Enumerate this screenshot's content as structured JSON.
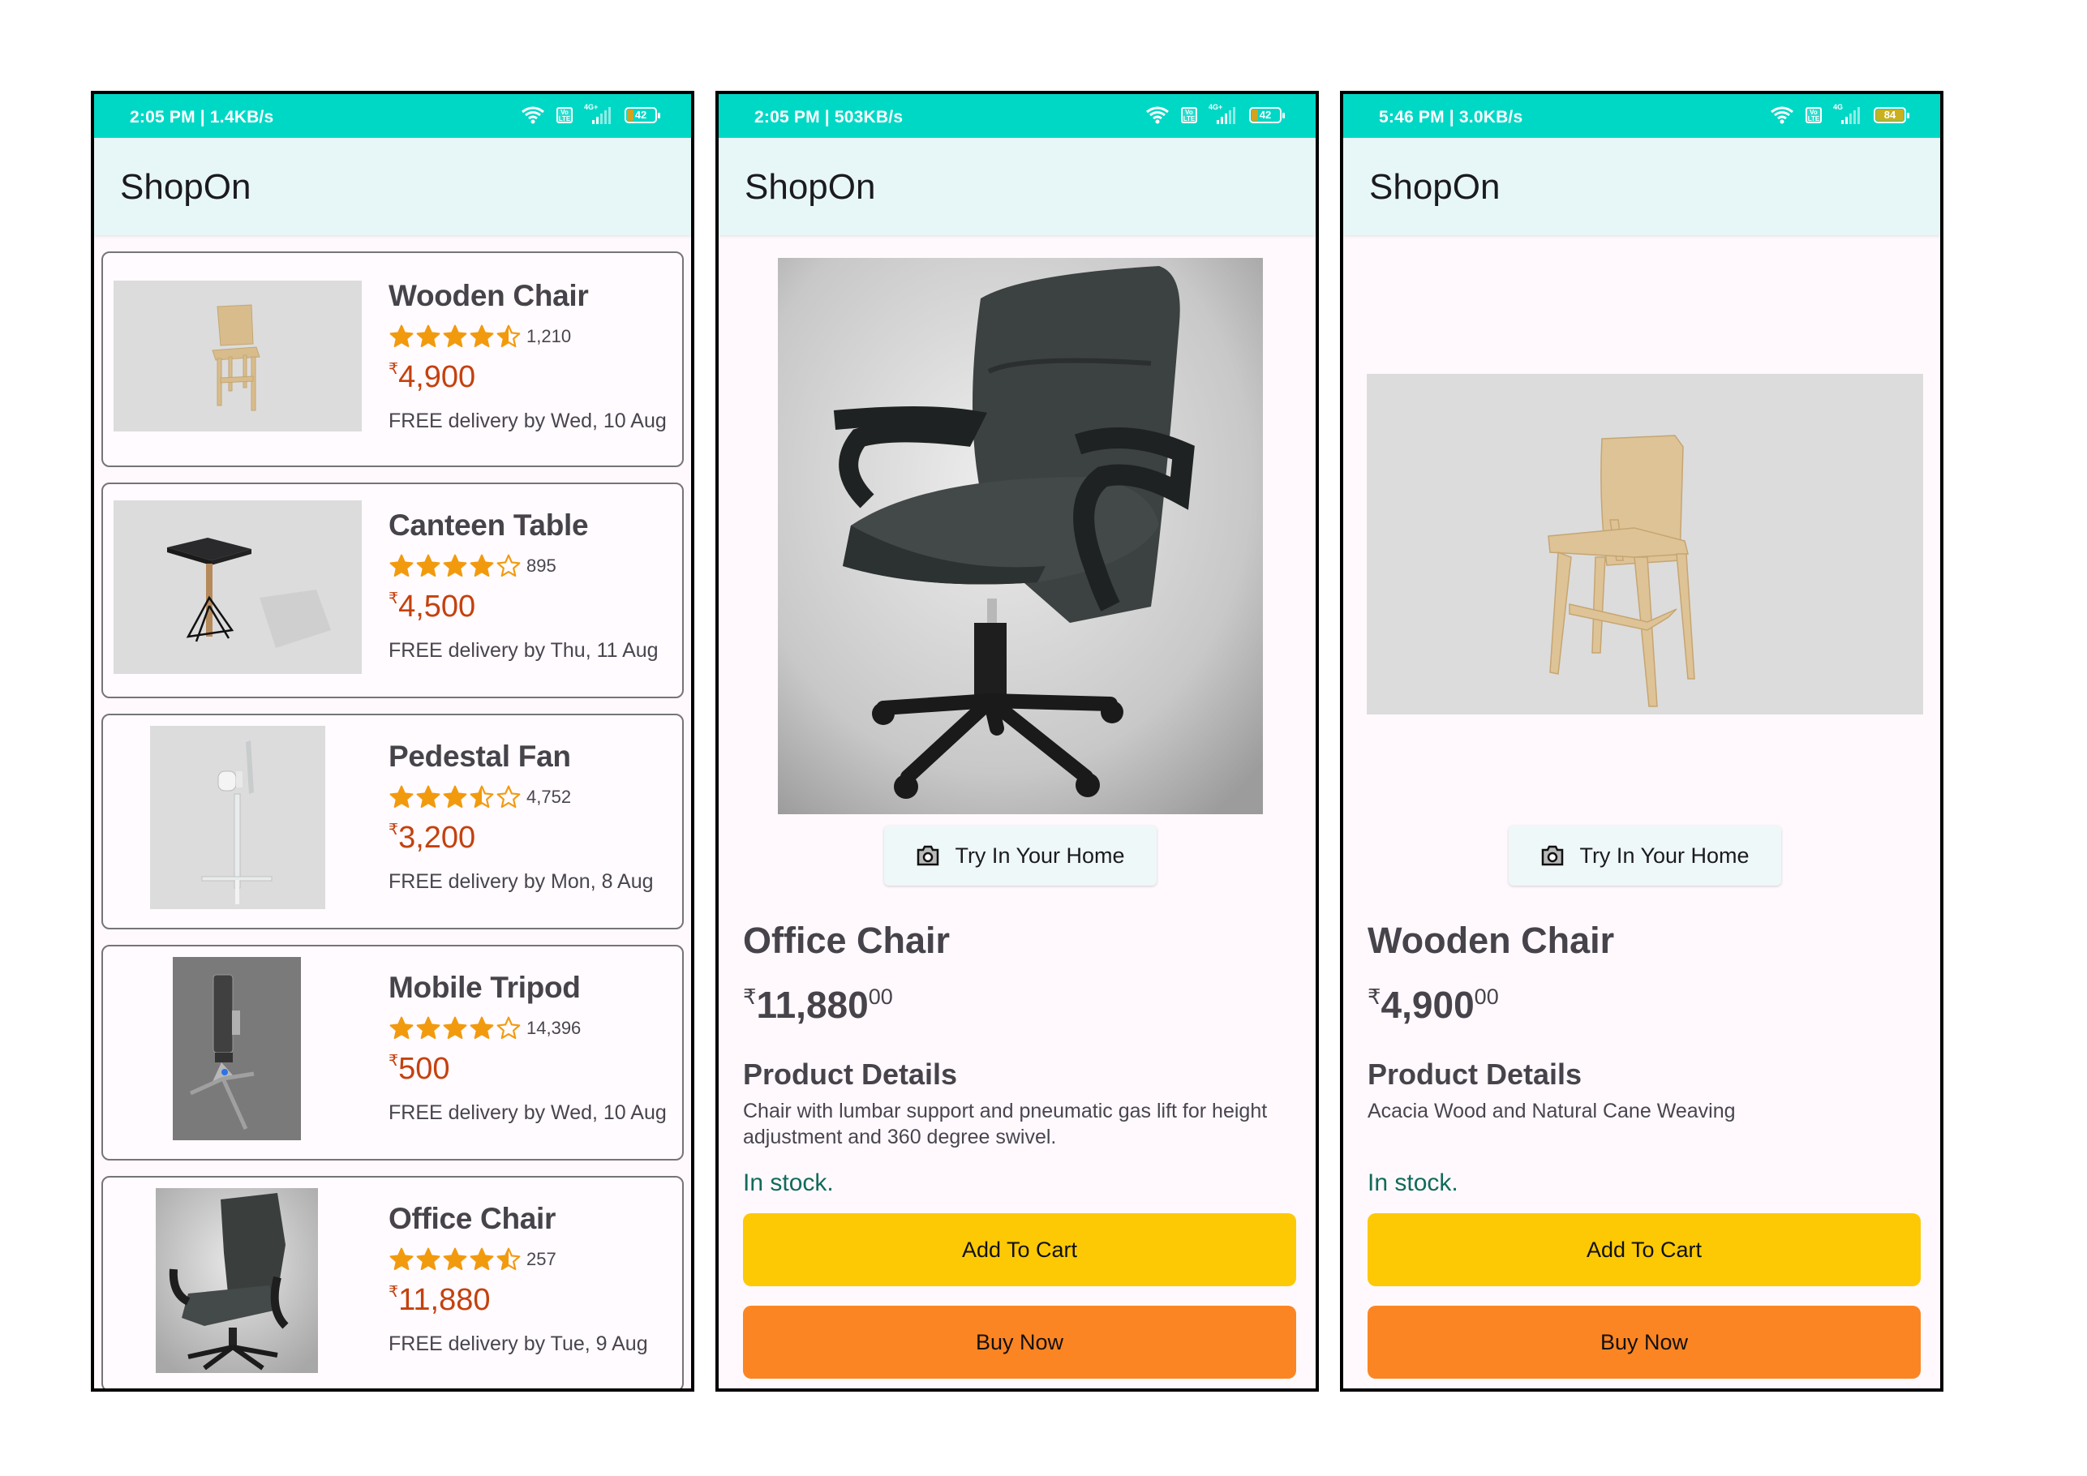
{
  "app": {
    "title": "ShopOn"
  },
  "colors": {
    "status_bar": "#00D8C6",
    "app_bar": "#E7F7F7",
    "price": "#C4410E",
    "star": "#F29A0E",
    "in_stock": "#106B5A",
    "add_to_cart": "#FDC905",
    "buy_now": "#FC8523"
  },
  "screens": [
    {
      "status": {
        "time_speed": "2:05 PM | 1.4KB/s",
        "network": "4G+",
        "battery": "42",
        "volte": "Vo LTE"
      },
      "products": [
        {
          "name": "Wooden Chair",
          "rating": 4.5,
          "rating_count": "1,210",
          "currency": "₹",
          "price": "4,900",
          "delivery": "FREE delivery by Wed, 10 Aug",
          "image": "wooden-chair"
        },
        {
          "name": "Canteen Table",
          "rating": 4,
          "rating_count": "895",
          "currency": "₹",
          "price": "4,500",
          "delivery": "FREE delivery by Thu, 11 Aug",
          "image": "canteen-table"
        },
        {
          "name": "Pedestal Fan",
          "rating": 3.5,
          "rating_count": "4,752",
          "currency": "₹",
          "price": "3,200",
          "delivery": "FREE delivery by Mon, 8 Aug",
          "image": "pedestal-fan"
        },
        {
          "name": "Mobile Tripod",
          "rating": 4,
          "rating_count": "14,396",
          "currency": "₹",
          "price": "500",
          "delivery": "FREE delivery by Wed, 10 Aug",
          "image": "mobile-tripod"
        },
        {
          "name": "Office Chair",
          "rating": 4.5,
          "rating_count": "257",
          "currency": "₹",
          "price": "11,880",
          "delivery": "FREE delivery by Tue, 9 Aug",
          "image": "office-chair"
        }
      ]
    },
    {
      "status": {
        "time_speed": "2:05 PM | 503KB/s",
        "network": "4G+",
        "battery": "42",
        "volte": "Vo LTE"
      },
      "detail": {
        "image": "office-chair",
        "try_button": "Try In Your Home",
        "name": "Office Chair",
        "currency": "₹",
        "price_whole": "11,880",
        "price_fraction": "00",
        "section_title": "Product Details",
        "description": "Chair with lumbar support and pneumatic gas lift for height adjustment and 360 degree swivel.",
        "stock": "In stock.",
        "add_to_cart": "Add To Cart",
        "buy_now": "Buy Now"
      }
    },
    {
      "status": {
        "time_speed": "5:46 PM | 3.0KB/s",
        "network": "4G",
        "battery": "84",
        "volte": "Vo LTE"
      },
      "detail": {
        "image": "wooden-chair",
        "try_button": "Try In Your Home",
        "name": "Wooden Chair",
        "currency": "₹",
        "price_whole": "4,900",
        "price_fraction": "00",
        "section_title": "Product Details",
        "description": "Acacia Wood and Natural Cane Weaving",
        "stock": "In stock.",
        "add_to_cart": "Add To Cart",
        "buy_now": "Buy Now"
      }
    }
  ]
}
